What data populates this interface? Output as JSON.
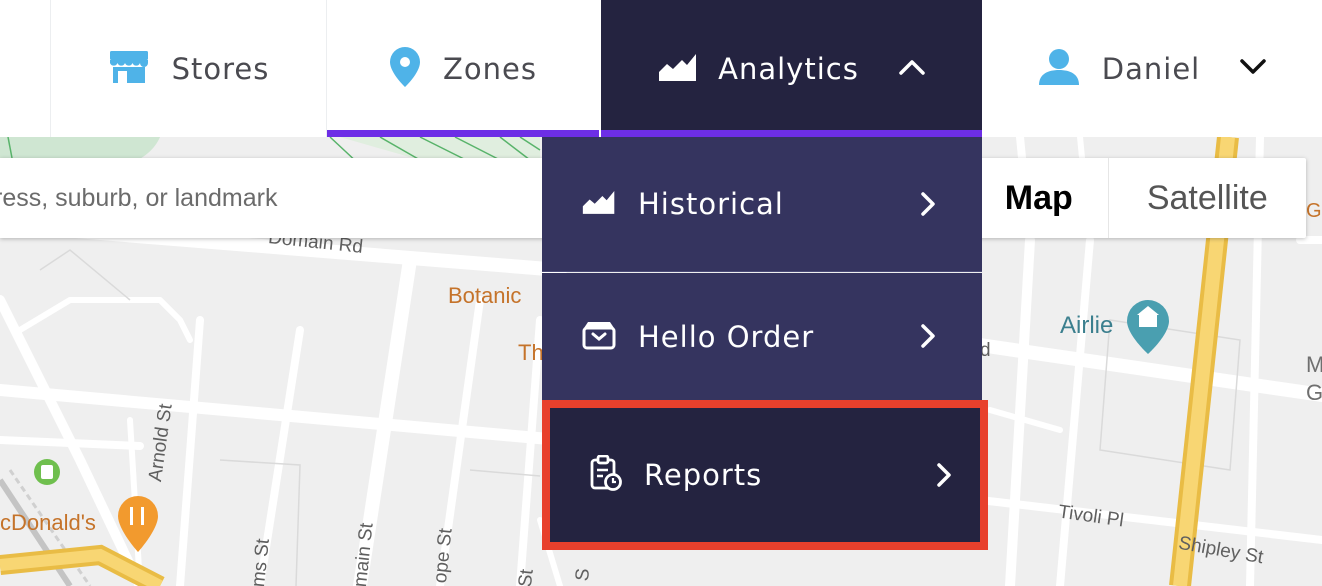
{
  "nav": {
    "stores_label": "Stores",
    "zones_label": "Zones",
    "analytics_label": "Analytics",
    "user_name": "Daniel"
  },
  "search": {
    "placeholder": "ress, suburb, or landmark"
  },
  "map_type": {
    "map_label": "Map",
    "satellite_label": "Satellite"
  },
  "dropdown": {
    "items": [
      {
        "label": "Historical",
        "icon": "area-chart-icon"
      },
      {
        "label": "Hello Order",
        "icon": "box-icon"
      },
      {
        "label": "Reports",
        "icon": "clipboard-clock-icon"
      }
    ]
  },
  "map_labels": {
    "domain_rd": "Domain Rd",
    "botanic": "Botanic",
    "th": "Th",
    "d": "d",
    "airlie": "Airlie",
    "m": "M",
    "g": "G",
    "tivoli_pl": "Tivoli Pl",
    "shipley_st": "Shipley St",
    "arnold_st": "Arnold St",
    "mcdonalds": "cDonald's",
    "ms_st": "ms St",
    "main_st": "main St",
    "ope_st": "ope St",
    "st": "St",
    "s": "S",
    "gre": "Gre"
  },
  "colors": {
    "nav_active_bg": "#242340",
    "dropdown_bg": "#35345f",
    "accent_underline": "#6d2ee6",
    "highlight_border": "#e8402c",
    "icon_blue": "#4fb3e8"
  }
}
